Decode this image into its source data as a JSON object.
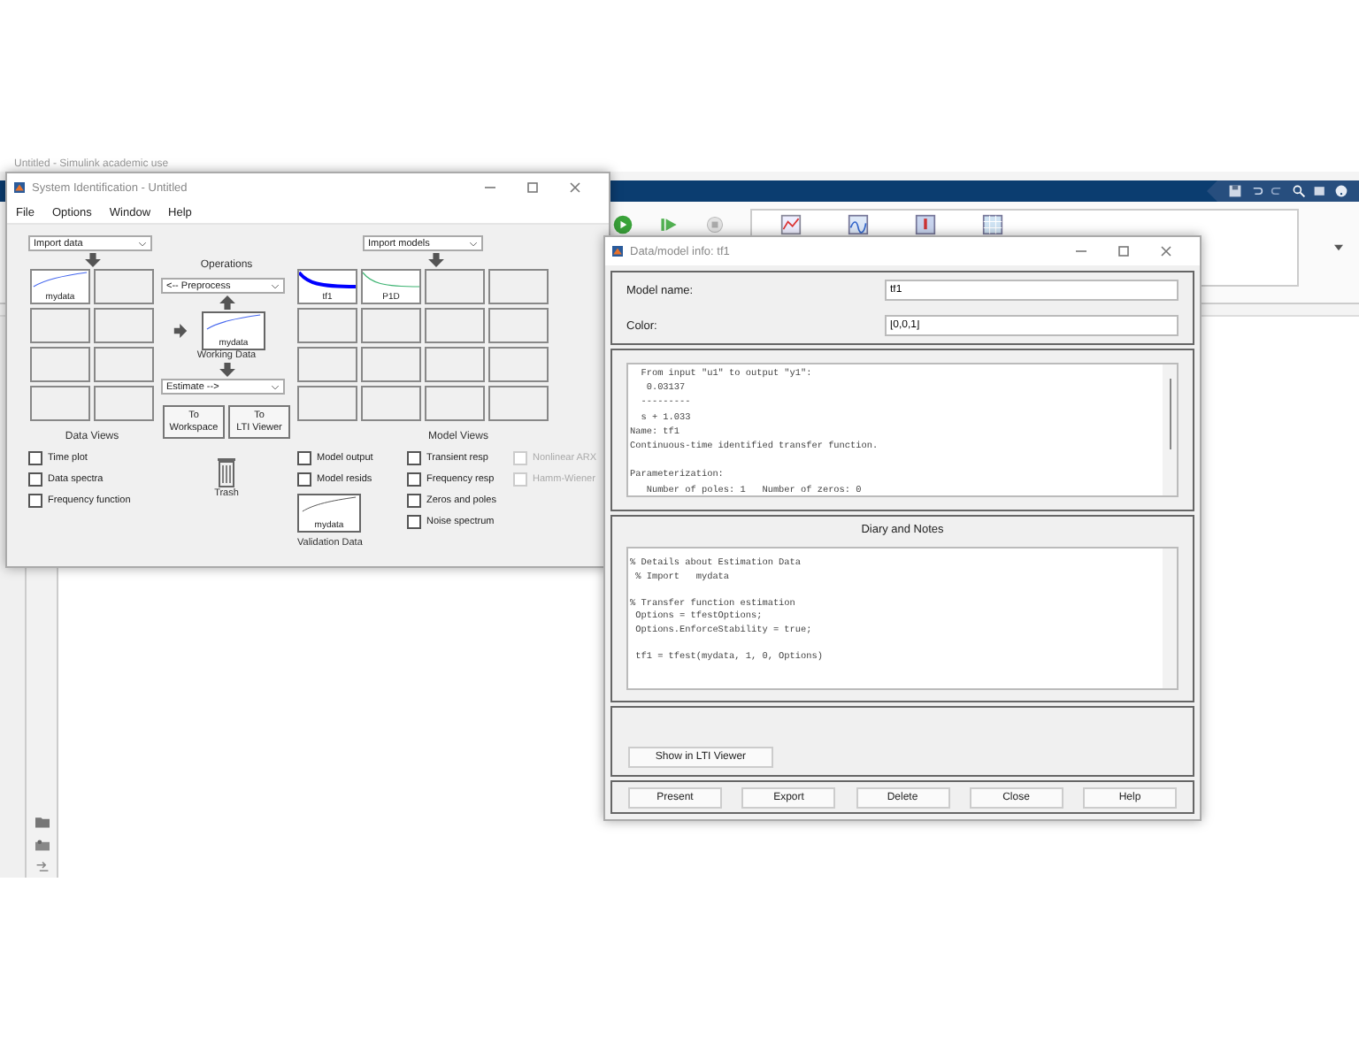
{
  "background_app": {
    "title": "Untitled - Simulink academic use"
  },
  "sysid_window": {
    "title": "System Identification - Untitled",
    "menu": [
      "File",
      "Options",
      "Window",
      "Help"
    ],
    "import_data": "Import data",
    "data_boards": [
      {
        "kind": "data",
        "label": "mydata"
      },
      {
        "kind": "empty"
      },
      {
        "kind": "empty"
      },
      {
        "kind": "empty"
      },
      {
        "kind": "empty"
      },
      {
        "kind": "empty"
      },
      {
        "kind": "empty"
      },
      {
        "kind": "empty"
      }
    ],
    "data_views": {
      "title": "Data Views",
      "options": [
        {
          "label": "Time plot",
          "checked": false
        },
        {
          "label": "Data spectra",
          "checked": false
        },
        {
          "label": "Frequency function",
          "checked": false
        }
      ]
    },
    "operations": {
      "title": "Operations",
      "preprocess": "<-- Preprocess",
      "working_data": {
        "label": "mydata",
        "caption": "Working Data"
      },
      "estimate": "Estimate -->",
      "buttons": [
        "To\nWorkspace",
        "To\nLTI Viewer"
      ],
      "trash": "Trash"
    },
    "import_models": "Import models",
    "model_boards": [
      {
        "kind": "model",
        "label": "tf1",
        "color": "#0000ff"
      },
      {
        "kind": "model",
        "label": "P1D",
        "color": "#3cb371"
      },
      {
        "kind": "empty"
      },
      {
        "kind": "empty"
      },
      {
        "kind": "empty"
      },
      {
        "kind": "empty"
      },
      {
        "kind": "empty"
      },
      {
        "kind": "empty"
      },
      {
        "kind": "empty"
      },
      {
        "kind": "empty"
      },
      {
        "kind": "empty"
      },
      {
        "kind": "empty"
      },
      {
        "kind": "empty"
      },
      {
        "kind": "empty"
      },
      {
        "kind": "empty"
      },
      {
        "kind": "empty"
      }
    ],
    "model_views": {
      "title": "Model Views",
      "options": [
        {
          "label": "Model output",
          "checked": false,
          "disabled": false
        },
        {
          "label": "Transient resp",
          "checked": false,
          "disabled": false
        },
        {
          "label": "Nonlinear ARX",
          "checked": false,
          "disabled": true
        },
        {
          "label": "Model resids",
          "checked": false,
          "disabled": false
        },
        {
          "label": "Frequency resp",
          "checked": false,
          "disabled": false
        },
        {
          "label": "Hamm-Wiener",
          "checked": false,
          "disabled": true
        },
        {
          "label": "Zeros and poles",
          "checked": false,
          "disabled": false
        },
        {
          "label": "Noise spectrum",
          "checked": false,
          "disabled": false
        }
      ]
    },
    "validation_data": {
      "label": "mydata",
      "caption": "Validation Data"
    }
  },
  "info_window": {
    "title": "Data/model info: tf1",
    "model_name": {
      "label": "Model name:",
      "value": "tf1"
    },
    "color": {
      "label": "Color:",
      "value": "[0,0,1]"
    },
    "info_text": "  From input \"u1\" to output \"y1\":\n   0.03137\n  ---------\n  s + 1.033\nName: tf1\nContinuous-time identified transfer function.\n\nParameterization:\n   Number of poles: 1   Number of zeros: 0",
    "diary_title": "Diary and Notes",
    "diary_text": "% Details about Estimation Data\n % Import   mydata\n\n% Transfer function estimation\n Options = tfestOptions;\n Options.EnforceStability = true;\n\n tf1 = tfest(mydata, 1, 0, Options)",
    "lti_button": "Show in LTI Viewer",
    "buttons": [
      "Present",
      "Export",
      "Delete",
      "Close",
      "Help"
    ]
  }
}
